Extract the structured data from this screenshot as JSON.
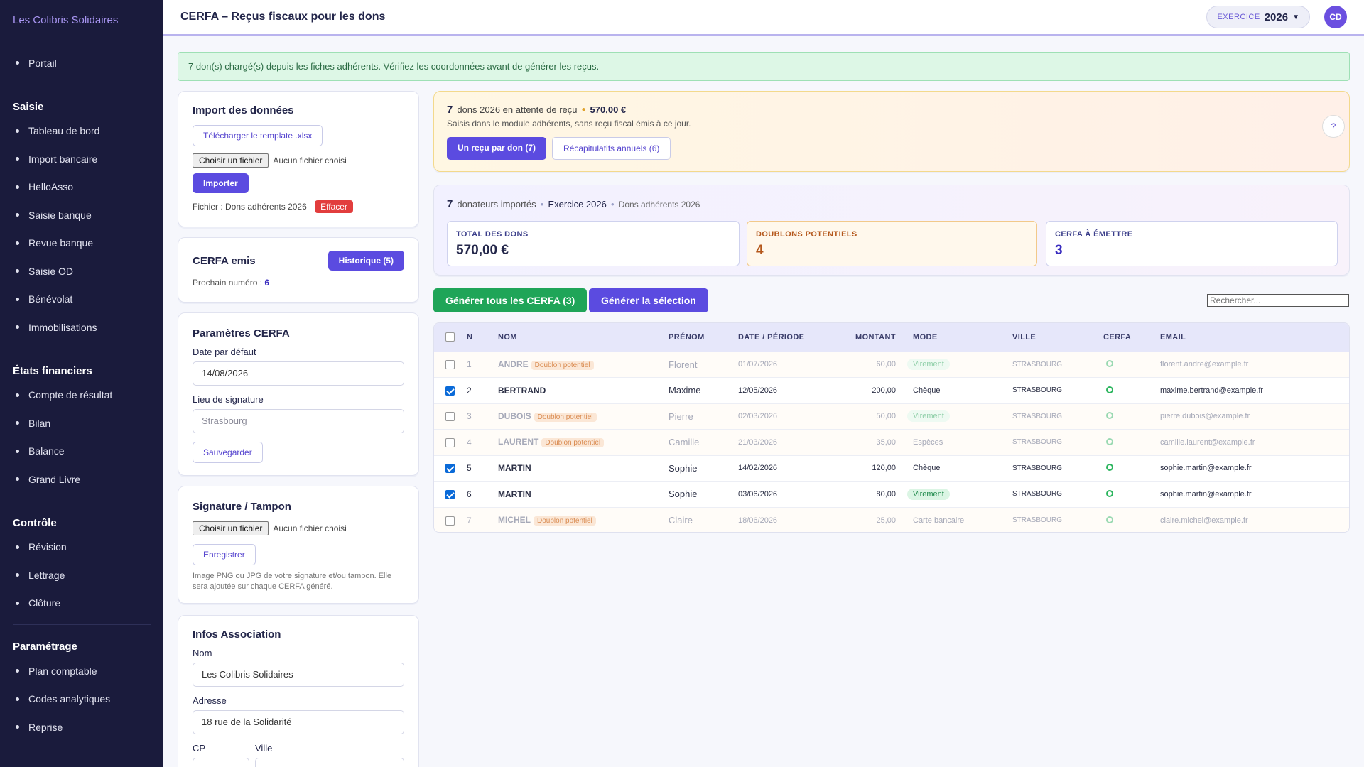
{
  "sidebar": {
    "brand": "Les Colibris Solidaires",
    "portal": "Portail",
    "sections": [
      {
        "title": "Saisie",
        "items": [
          "Tableau de bord",
          "Import bancaire",
          "HelloAsso",
          "Saisie banque",
          "Revue banque",
          "Saisie OD",
          "Bénévolat",
          "Immobilisations"
        ]
      },
      {
        "title": "États financiers",
        "items": [
          "Compte de résultat",
          "Bilan",
          "Balance",
          "Grand Livre"
        ]
      },
      {
        "title": "Contrôle",
        "items": [
          "Révision",
          "Lettrage",
          "Clôture"
        ]
      },
      {
        "title": "Paramétrage",
        "items": [
          "Plan comptable",
          "Codes analytiques",
          "Reprise"
        ]
      }
    ]
  },
  "header": {
    "title": "CERFA – Reçus fiscaux pour les dons",
    "exercice_label": "EXERCICE",
    "exercice_year": "2026",
    "avatar": "CD"
  },
  "alert": "7 don(s) chargé(s) depuis les fiches adhérents. Vérifiez les coordonnées avant de générer les reçus.",
  "import": {
    "title": "Import des données",
    "template_btn": "Télécharger le template .xlsx",
    "file_btn": "Choisir un fichier",
    "no_file": "Aucun fichier choisi",
    "import_btn": "Importer",
    "file_label": "Fichier : Dons adhérents 2026",
    "clear_btn": "Effacer"
  },
  "cerfa_emis": {
    "title": "CERFA emis",
    "history_btn": "Historique (5)",
    "next_label": "Prochain numéro :",
    "next_value": "6"
  },
  "params": {
    "title": "Paramètres CERFA",
    "date_label": "Date par défaut",
    "date_value": "14/08/2026",
    "lieu_label": "Lieu de signature",
    "lieu_placeholder": "Strasbourg",
    "save_btn": "Sauvegarder"
  },
  "signature": {
    "title": "Signature / Tampon",
    "file_btn": "Choisir un fichier",
    "no_file": "Aucun fichier choisi",
    "save_btn": "Enregistrer",
    "note": "Image PNG ou JPG de votre signature et/ou tampon. Elle sera ajoutée sur chaque CERFA généré."
  },
  "assoc": {
    "title": "Infos Association",
    "nom_label": "Nom",
    "nom_value": "Les Colibris Solidaires",
    "adresse_label": "Adresse",
    "adresse_value": "18 rue de la Solidarité",
    "cp_label": "CP",
    "ville_label": "Ville"
  },
  "pending": {
    "count": "7",
    "text": "dons 2026 en attente de reçu",
    "amount": "570,00 €",
    "sub": "Saisis dans le module adhérents, sans reçu fiscal émis à ce jour.",
    "btn_one": "Un reçu par don (7)",
    "btn_recap": "Récapitulatifs annuels (6)",
    "help": "?"
  },
  "summary": {
    "count": "7",
    "label": "donateurs importés",
    "exercice": "Exercice 2026",
    "source": "Dons adhérents 2026",
    "stats": [
      {
        "label": "TOTAL DES DONS",
        "value": "570,00 €"
      },
      {
        "label": "DOUBLONS POTENTIELS",
        "value": "4"
      },
      {
        "label": "CERFA À ÉMETTRE",
        "value": "3"
      }
    ]
  },
  "actions": {
    "gen_all": "Générer tous les CERFA (3)",
    "gen_sel": "Générer la sélection",
    "search_placeholder": "Rechercher..."
  },
  "table": {
    "headers": [
      "N",
      "NOM",
      "PRÉNOM",
      "DATE / PÉRIODE",
      "MONTANT",
      "MODE",
      "VILLE",
      "CERFA",
      "EMAIL"
    ],
    "dup_badge": "Doublon potentiel",
    "rows": [
      {
        "n": "1",
        "nom": "ANDRE",
        "dup": true,
        "checked": false,
        "prenom": "Florent",
        "date": "01/07/2026",
        "montant": "60,00",
        "mode": "Virement",
        "ville": "STRASBOURG",
        "email": "florent.andre@example.fr"
      },
      {
        "n": "2",
        "nom": "BERTRAND",
        "dup": false,
        "checked": true,
        "prenom": "Maxime",
        "date": "12/05/2026",
        "montant": "200,00",
        "mode": "Chèque",
        "ville": "STRASBOURG",
        "email": "maxime.bertrand@example.fr"
      },
      {
        "n": "3",
        "nom": "DUBOIS",
        "dup": true,
        "checked": false,
        "prenom": "Pierre",
        "date": "02/03/2026",
        "montant": "50,00",
        "mode": "Virement",
        "ville": "STRASBOURG",
        "email": "pierre.dubois@example.fr"
      },
      {
        "n": "4",
        "nom": "LAURENT",
        "dup": true,
        "checked": false,
        "prenom": "Camille",
        "date": "21/03/2026",
        "montant": "35,00",
        "mode": "Espèces",
        "ville": "STRASBOURG",
        "email": "camille.laurent@example.fr"
      },
      {
        "n": "5",
        "nom": "MARTIN",
        "dup": false,
        "checked": true,
        "prenom": "Sophie",
        "date": "14/02/2026",
        "montant": "120,00",
        "mode": "Chèque",
        "ville": "STRASBOURG",
        "email": "sophie.martin@example.fr"
      },
      {
        "n": "6",
        "nom": "MARTIN",
        "dup": false,
        "checked": true,
        "prenom": "Sophie",
        "date": "03/06/2026",
        "montant": "80,00",
        "mode": "Virement",
        "ville": "STRASBOURG",
        "email": "sophie.martin@example.fr"
      },
      {
        "n": "7",
        "nom": "MICHEL",
        "dup": true,
        "checked": false,
        "prenom": "Claire",
        "date": "18/06/2026",
        "montant": "25,00",
        "mode": "Carte bancaire",
        "ville": "STRASBOURG",
        "email": "claire.michel@example.fr"
      }
    ]
  }
}
